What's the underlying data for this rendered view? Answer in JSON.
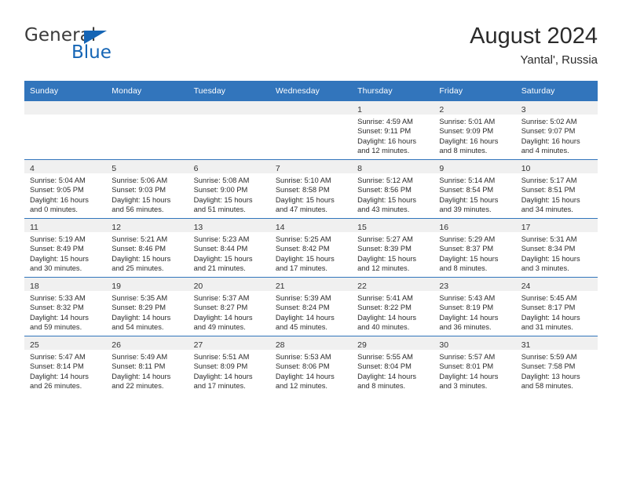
{
  "logo": {
    "word1": "General",
    "word2": "Blue",
    "triangle_color": "#1565b5"
  },
  "header": {
    "title": "August 2024",
    "location": "Yantal', Russia"
  },
  "theme": {
    "header_bg": "#3275bc",
    "daynum_bg": "#f0f0f0",
    "cell_bg": "#ffffff",
    "text": "#2b2b2b"
  },
  "weekday_headers": [
    "Sunday",
    "Monday",
    "Tuesday",
    "Wednesday",
    "Thursday",
    "Friday",
    "Saturday"
  ],
  "weeks": [
    [
      {
        "day": "",
        "lines": []
      },
      {
        "day": "",
        "lines": []
      },
      {
        "day": "",
        "lines": []
      },
      {
        "day": "",
        "lines": []
      },
      {
        "day": "1",
        "lines": [
          "Sunrise: 4:59 AM",
          "Sunset: 9:11 PM",
          "Daylight: 16 hours",
          "and 12 minutes."
        ]
      },
      {
        "day": "2",
        "lines": [
          "Sunrise: 5:01 AM",
          "Sunset: 9:09 PM",
          "Daylight: 16 hours",
          "and 8 minutes."
        ]
      },
      {
        "day": "3",
        "lines": [
          "Sunrise: 5:02 AM",
          "Sunset: 9:07 PM",
          "Daylight: 16 hours",
          "and 4 minutes."
        ]
      }
    ],
    [
      {
        "day": "4",
        "lines": [
          "Sunrise: 5:04 AM",
          "Sunset: 9:05 PM",
          "Daylight: 16 hours",
          "and 0 minutes."
        ]
      },
      {
        "day": "5",
        "lines": [
          "Sunrise: 5:06 AM",
          "Sunset: 9:03 PM",
          "Daylight: 15 hours",
          "and 56 minutes."
        ]
      },
      {
        "day": "6",
        "lines": [
          "Sunrise: 5:08 AM",
          "Sunset: 9:00 PM",
          "Daylight: 15 hours",
          "and 51 minutes."
        ]
      },
      {
        "day": "7",
        "lines": [
          "Sunrise: 5:10 AM",
          "Sunset: 8:58 PM",
          "Daylight: 15 hours",
          "and 47 minutes."
        ]
      },
      {
        "day": "8",
        "lines": [
          "Sunrise: 5:12 AM",
          "Sunset: 8:56 PM",
          "Daylight: 15 hours",
          "and 43 minutes."
        ]
      },
      {
        "day": "9",
        "lines": [
          "Sunrise: 5:14 AM",
          "Sunset: 8:54 PM",
          "Daylight: 15 hours",
          "and 39 minutes."
        ]
      },
      {
        "day": "10",
        "lines": [
          "Sunrise: 5:17 AM",
          "Sunset: 8:51 PM",
          "Daylight: 15 hours",
          "and 34 minutes."
        ]
      }
    ],
    [
      {
        "day": "11",
        "lines": [
          "Sunrise: 5:19 AM",
          "Sunset: 8:49 PM",
          "Daylight: 15 hours",
          "and 30 minutes."
        ]
      },
      {
        "day": "12",
        "lines": [
          "Sunrise: 5:21 AM",
          "Sunset: 8:46 PM",
          "Daylight: 15 hours",
          "and 25 minutes."
        ]
      },
      {
        "day": "13",
        "lines": [
          "Sunrise: 5:23 AM",
          "Sunset: 8:44 PM",
          "Daylight: 15 hours",
          "and 21 minutes."
        ]
      },
      {
        "day": "14",
        "lines": [
          "Sunrise: 5:25 AM",
          "Sunset: 8:42 PM",
          "Daylight: 15 hours",
          "and 17 minutes."
        ]
      },
      {
        "day": "15",
        "lines": [
          "Sunrise: 5:27 AM",
          "Sunset: 8:39 PM",
          "Daylight: 15 hours",
          "and 12 minutes."
        ]
      },
      {
        "day": "16",
        "lines": [
          "Sunrise: 5:29 AM",
          "Sunset: 8:37 PM",
          "Daylight: 15 hours",
          "and 8 minutes."
        ]
      },
      {
        "day": "17",
        "lines": [
          "Sunrise: 5:31 AM",
          "Sunset: 8:34 PM",
          "Daylight: 15 hours",
          "and 3 minutes."
        ]
      }
    ],
    [
      {
        "day": "18",
        "lines": [
          "Sunrise: 5:33 AM",
          "Sunset: 8:32 PM",
          "Daylight: 14 hours",
          "and 59 minutes."
        ]
      },
      {
        "day": "19",
        "lines": [
          "Sunrise: 5:35 AM",
          "Sunset: 8:29 PM",
          "Daylight: 14 hours",
          "and 54 minutes."
        ]
      },
      {
        "day": "20",
        "lines": [
          "Sunrise: 5:37 AM",
          "Sunset: 8:27 PM",
          "Daylight: 14 hours",
          "and 49 minutes."
        ]
      },
      {
        "day": "21",
        "lines": [
          "Sunrise: 5:39 AM",
          "Sunset: 8:24 PM",
          "Daylight: 14 hours",
          "and 45 minutes."
        ]
      },
      {
        "day": "22",
        "lines": [
          "Sunrise: 5:41 AM",
          "Sunset: 8:22 PM",
          "Daylight: 14 hours",
          "and 40 minutes."
        ]
      },
      {
        "day": "23",
        "lines": [
          "Sunrise: 5:43 AM",
          "Sunset: 8:19 PM",
          "Daylight: 14 hours",
          "and 36 minutes."
        ]
      },
      {
        "day": "24",
        "lines": [
          "Sunrise: 5:45 AM",
          "Sunset: 8:17 PM",
          "Daylight: 14 hours",
          "and 31 minutes."
        ]
      }
    ],
    [
      {
        "day": "25",
        "lines": [
          "Sunrise: 5:47 AM",
          "Sunset: 8:14 PM",
          "Daylight: 14 hours",
          "and 26 minutes."
        ]
      },
      {
        "day": "26",
        "lines": [
          "Sunrise: 5:49 AM",
          "Sunset: 8:11 PM",
          "Daylight: 14 hours",
          "and 22 minutes."
        ]
      },
      {
        "day": "27",
        "lines": [
          "Sunrise: 5:51 AM",
          "Sunset: 8:09 PM",
          "Daylight: 14 hours",
          "and 17 minutes."
        ]
      },
      {
        "day": "28",
        "lines": [
          "Sunrise: 5:53 AM",
          "Sunset: 8:06 PM",
          "Daylight: 14 hours",
          "and 12 minutes."
        ]
      },
      {
        "day": "29",
        "lines": [
          "Sunrise: 5:55 AM",
          "Sunset: 8:04 PM",
          "Daylight: 14 hours",
          "and 8 minutes."
        ]
      },
      {
        "day": "30",
        "lines": [
          "Sunrise: 5:57 AM",
          "Sunset: 8:01 PM",
          "Daylight: 14 hours",
          "and 3 minutes."
        ]
      },
      {
        "day": "31",
        "lines": [
          "Sunrise: 5:59 AM",
          "Sunset: 7:58 PM",
          "Daylight: 13 hours",
          "and 58 minutes."
        ]
      }
    ]
  ]
}
